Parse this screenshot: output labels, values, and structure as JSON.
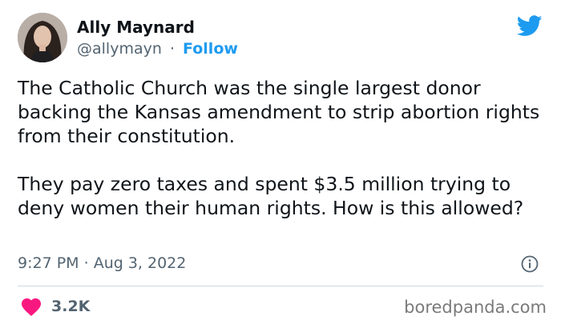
{
  "author": {
    "name": "Ally Maynard",
    "handle": "@allymayn",
    "separator": "·",
    "follow_label": "Follow"
  },
  "tweet": {
    "paragraphs": [
      "The Catholic Church was the single largest donor backing the Kansas amendment to strip abortion rights from their constitution.",
      "They pay zero taxes and spent $3.5 million trying to deny women their human rights. How is this allowed?"
    ],
    "time": "9:27 PM",
    "date_separator": "·",
    "date": "Aug 3, 2022"
  },
  "engagement": {
    "likes": "3.2K"
  },
  "watermark": "boredpanda.com",
  "icons": {
    "brand": "twitter-bird-icon",
    "info": "info-icon",
    "like": "heart-icon"
  },
  "colors": {
    "twitter_blue": "#1d9bf0",
    "heart": "#f91880",
    "secondary_text": "#536471"
  }
}
